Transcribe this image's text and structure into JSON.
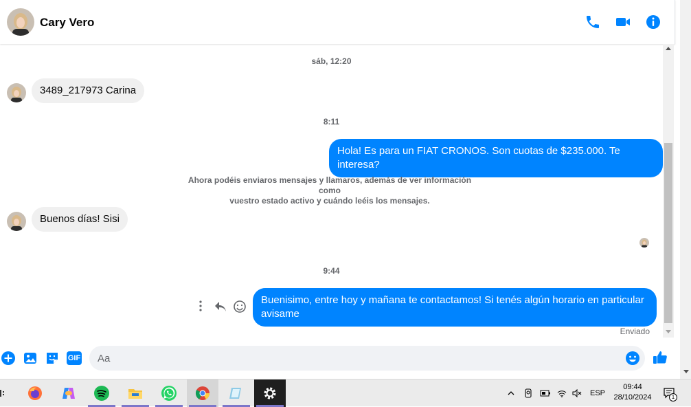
{
  "header": {
    "contact_name": "Cary Vero",
    "icons": [
      "phone-icon",
      "video-camera-icon",
      "info-icon"
    ],
    "accent": "#0084ff"
  },
  "messages": {
    "ts1": "sáb, 12:20",
    "in1": "3489_217973 Carina",
    "ts2": "8:11",
    "out1": "Hola! Es para un FIAT CRONOS. Son cuotas de $235.000. Te interesa?",
    "system_line1": "Ahora podéis enviaros mensajes y llamaros, además de ver información como",
    "system_line2": "vuestro estado activo y cuándo leéis los mensajes.",
    "in2": "Buenos días! Sisi",
    "ts3": "9:44",
    "out2_line1": "Buenisimo, entre hoy y mañana te contactamos! Si tenés algún horario en particular",
    "out2_line2": "avisame",
    "status": "Enviado"
  },
  "composer": {
    "placeholder": "Aa",
    "icons": [
      "plus-icon",
      "image-icon",
      "sticker-icon",
      "gif-icon",
      "emoji-icon",
      "thumbs-up-icon"
    ],
    "gif_label": "GIF"
  },
  "taskbar": {
    "apps": [
      "firefox-icon",
      "copilot-icon",
      "spotify-icon",
      "file-explorer-icon",
      "whatsapp-icon",
      "chrome-icon",
      "notepad-icon",
      "settings-icon"
    ],
    "lang": "ESP",
    "time": "09:44",
    "date": "28/10/2024",
    "notif_count": "1"
  }
}
